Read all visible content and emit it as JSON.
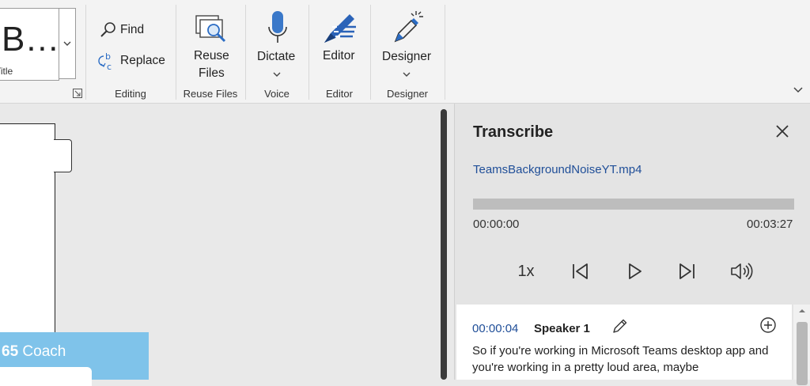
{
  "ribbon": {
    "style_gallery": {
      "preview": "B…",
      "name": "Title"
    },
    "editing": {
      "find": "Find",
      "replace": "Replace",
      "group": "Editing"
    },
    "reuse": {
      "line1": "Reuse",
      "line2": "Files",
      "group": "Reuse Files"
    },
    "voice": {
      "dictate": "Dictate",
      "group": "Voice"
    },
    "editor": {
      "label": "Editor",
      "group": "Editor"
    },
    "designer": {
      "label": "Designer",
      "group": "Designer"
    }
  },
  "document": {
    "coach_prefix": "65",
    "coach_label": " Coach"
  },
  "transcribe": {
    "title": "Transcribe",
    "file": "TeamsBackgroundNoiseYT.mp4",
    "progress": 0.0,
    "time_current": "00:00:00",
    "time_total": "00:03:27",
    "speed": "1x",
    "entry": {
      "time": "00:00:04",
      "speaker": "Speaker 1",
      "text": "So if you're working in Microsoft Teams desktop app and you're working in a pretty loud area, maybe"
    }
  },
  "icons": [
    "find-icon",
    "replace-icon",
    "reuse-files-icon",
    "microphone-icon",
    "editor-icon",
    "designer-icon",
    "close-icon",
    "previous-icon",
    "play-icon",
    "next-icon",
    "volume-icon",
    "edit-icon",
    "add-circle-icon",
    "chevron-down-icon"
  ],
  "colors": {
    "link": "#1f4e98",
    "mic": "#3a78c9",
    "coach": "#7fc3ea"
  }
}
